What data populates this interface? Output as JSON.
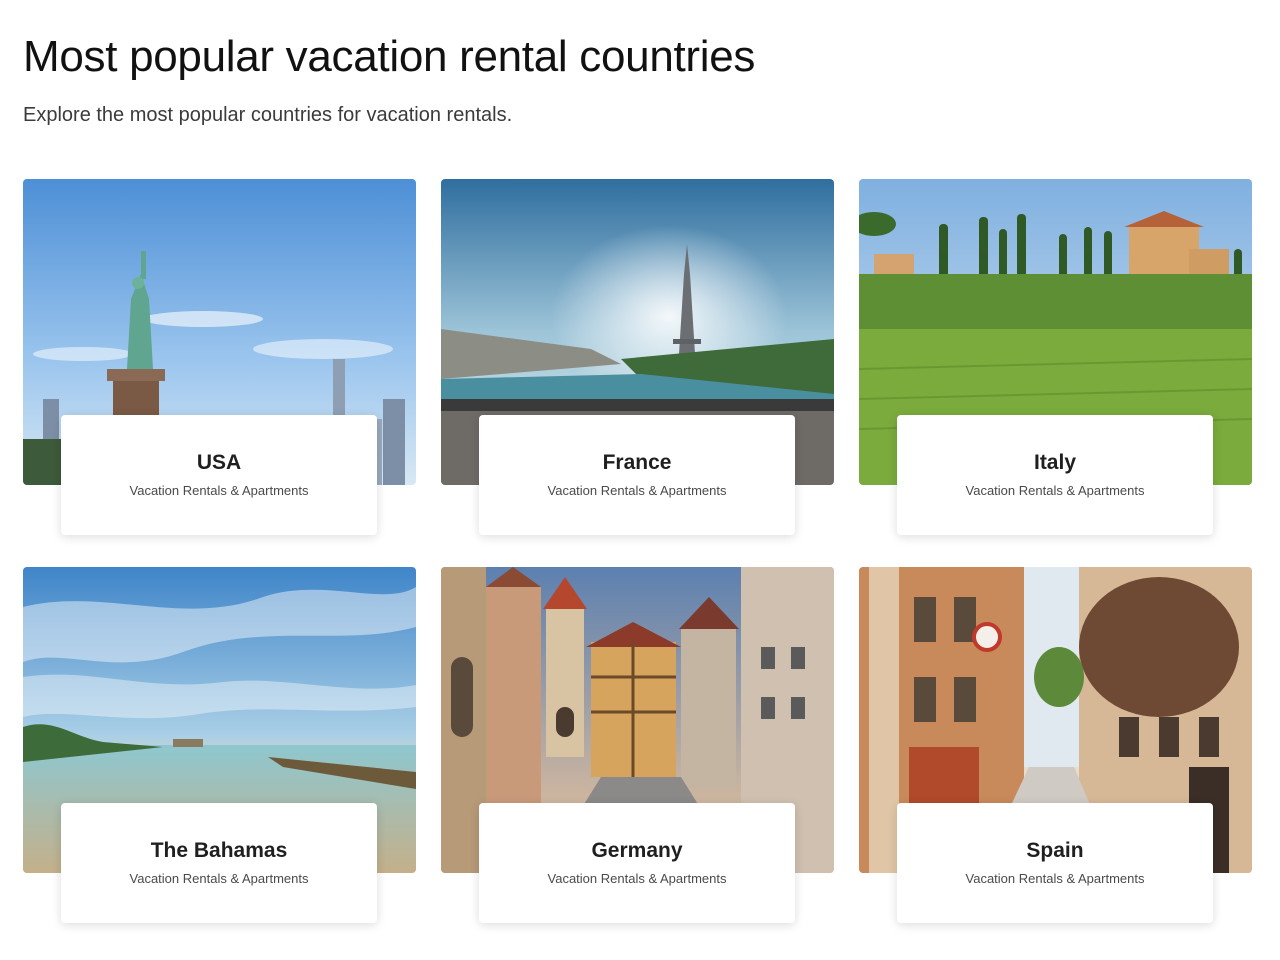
{
  "header": {
    "title": "Most popular vacation rental countries",
    "subtitle": "Explore the most popular countries for vacation rentals."
  },
  "cards": [
    {
      "name": "USA",
      "description": "Vacation Rentals & Apartments",
      "image": "statue-of-liberty-skyline"
    },
    {
      "name": "France",
      "description": "Vacation Rentals & Apartments",
      "image": "eiffel-tower-seine"
    },
    {
      "name": "Italy",
      "description": "Vacation Rentals & Apartments",
      "image": "tuscan-villa-vineyard"
    },
    {
      "name": "The Bahamas",
      "description": "Vacation Rentals & Apartments",
      "image": "beach-lagoon-sunset"
    },
    {
      "name": "Germany",
      "description": "Vacation Rentals & Apartments",
      "image": "half-timbered-old-town"
    },
    {
      "name": "Spain",
      "description": "Vacation Rentals & Apartments",
      "image": "narrow-old-street"
    }
  ]
}
